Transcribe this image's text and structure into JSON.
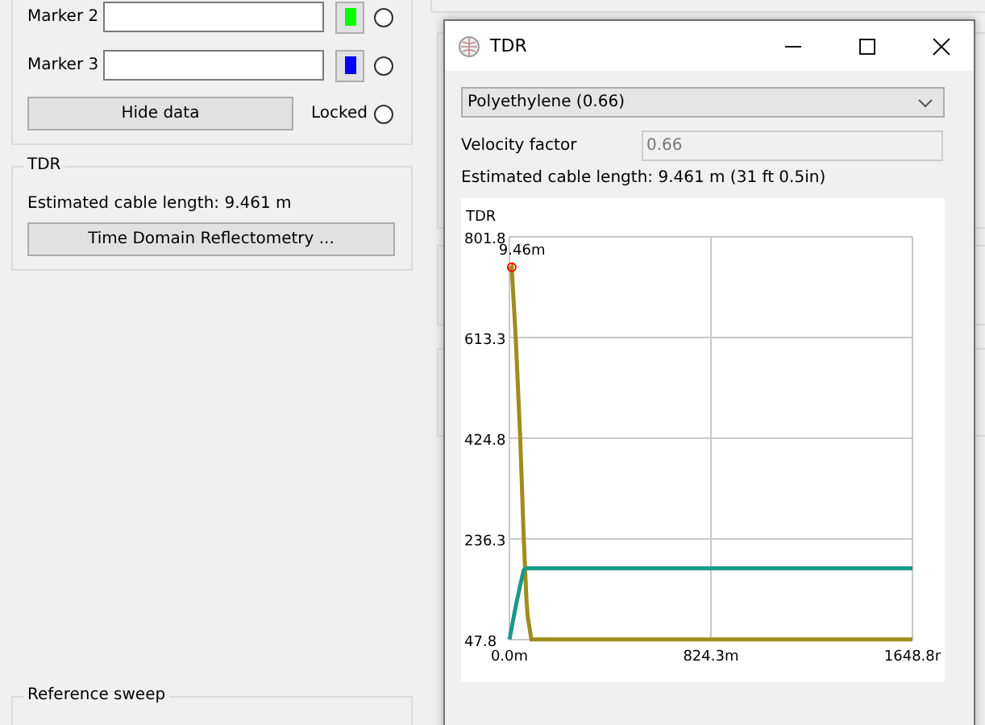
{
  "markers": [
    {
      "label": "Marker 2",
      "color": "#00ff00",
      "selected": false
    },
    {
      "label": "Marker 3",
      "color": "#0000ff",
      "selected": false
    }
  ],
  "hide_button": "Hide data",
  "locked": {
    "label": "Locked",
    "checked": false
  },
  "tdr_group": {
    "title": "TDR",
    "estimate": "Estimated cable length:  9.461  m",
    "button": "Time Domain Reflectometry ..."
  },
  "reference_group": {
    "title": "Reference sweep"
  },
  "tdr_window": {
    "title": "TDR",
    "cable_type": "Polyethylene (0.66)",
    "velocity_label": "Velocity factor",
    "velocity_value": "0.66",
    "estimate": "Estimated cable length:  9.461  m (31 ft 0.5in)",
    "chart_data": {
      "type": "line",
      "title": "TDR",
      "grid": true,
      "x": [
        0,
        9.46,
        26,
        44,
        59,
        70,
        75,
        90,
        824.3,
        1648.8
      ],
      "series": [
        {
          "color": "#a08c1c",
          "values": [
            740,
            745,
            613,
            425,
            236,
            120,
            90,
            48,
            48,
            48
          ]
        },
        {
          "color": "#1a9a88",
          "values": [
            48,
            70,
            110,
            150,
            178,
            181,
            181,
            181,
            181,
            181
          ]
        }
      ],
      "xlim": [
        0,
        1648.8
      ],
      "ylim": [
        47.8,
        801.8
      ],
      "xticks": [
        {
          "value": 0,
          "label": "0.0m"
        },
        {
          "value": 824.3,
          "label": "824.3m"
        },
        {
          "value": 1648.8,
          "label": "1648.8r"
        }
      ],
      "yticks": [
        {
          "value": 47.8,
          "label": "47.8"
        },
        {
          "value": 236.3,
          "label": "236.3"
        },
        {
          "value": 424.8,
          "label": "424.8"
        },
        {
          "value": 613.3,
          "label": "613.3"
        },
        {
          "value": 801.8,
          "label": "801.8"
        }
      ],
      "annotations": [
        {
          "x": 9.46,
          "y": 745,
          "text": "9.46m"
        }
      ]
    }
  }
}
